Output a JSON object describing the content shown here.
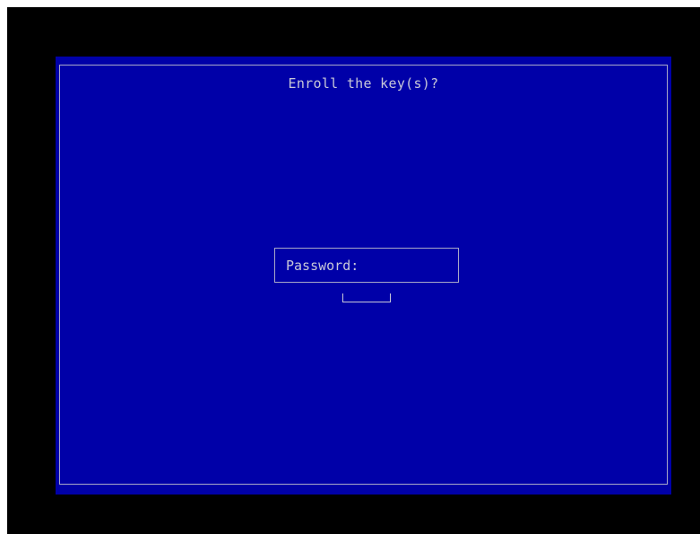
{
  "dialog": {
    "title": "Enroll the key(s)?",
    "password_label": "Password:",
    "password_value": ""
  },
  "colors": {
    "background": "#000000",
    "panel": "#0000a8",
    "text": "#c8c8d8",
    "border": "#a8a8c8"
  }
}
